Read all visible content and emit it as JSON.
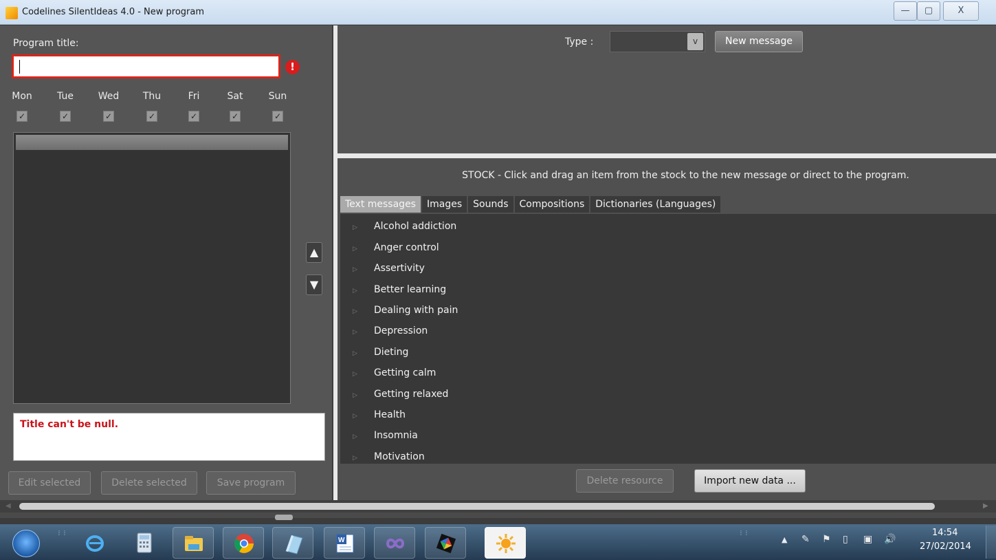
{
  "window": {
    "title": "Codelines SilentIdeas 4.0 - New program",
    "minimize_glyph": "—",
    "maximize_glyph": "▢",
    "close_glyph": "X"
  },
  "left": {
    "program_title_label": "Program title:",
    "program_title_value": "",
    "error_icon": "!",
    "days": [
      "Mon",
      "Tue",
      "Wed",
      "Thu",
      "Fri",
      "Sat",
      "Sun"
    ],
    "checkmark": "✓",
    "move_up": "▲",
    "move_down": "▼",
    "error_message": "Title can't be null.",
    "buttons": {
      "edit": "Edit selected",
      "delete": "Delete selected",
      "save": "Save program"
    }
  },
  "new_message": {
    "type_label": "Type :",
    "type_value": "",
    "chevron": "v",
    "new_message_label": "New message"
  },
  "stock": {
    "header": "STOCK - Click and drag an item from the stock to the new message or direct to the program.",
    "tabs": [
      "Text messages",
      "Images",
      "Sounds",
      "Compositions",
      "Dictionaries (Languages)"
    ],
    "active_tab": "Text messages",
    "tree_arrow": "▷",
    "items": [
      "Alcohol addiction",
      "Anger control",
      "Assertivity",
      "Better learning",
      "Dealing with pain",
      "Depression",
      "Dieting",
      "Getting calm",
      "Getting relaxed",
      "Health",
      "Insomnia",
      "Motivation"
    ],
    "delete_resource": "Delete resource",
    "import_data": "Import new data ..."
  },
  "scrollbar": {
    "left_arrow": "◀",
    "right_arrow": "▶"
  },
  "taskbar": {
    "grip": "⋮⋮",
    "tray_arrow": "▲",
    "tray_icons": [
      "✎",
      "⚑",
      "▯",
      "▣",
      "🔊"
    ],
    "time": "14:54",
    "date": "27/02/2014"
  },
  "colors": {
    "error": "#d8261a",
    "panel": "#555555",
    "list": "#383838"
  }
}
